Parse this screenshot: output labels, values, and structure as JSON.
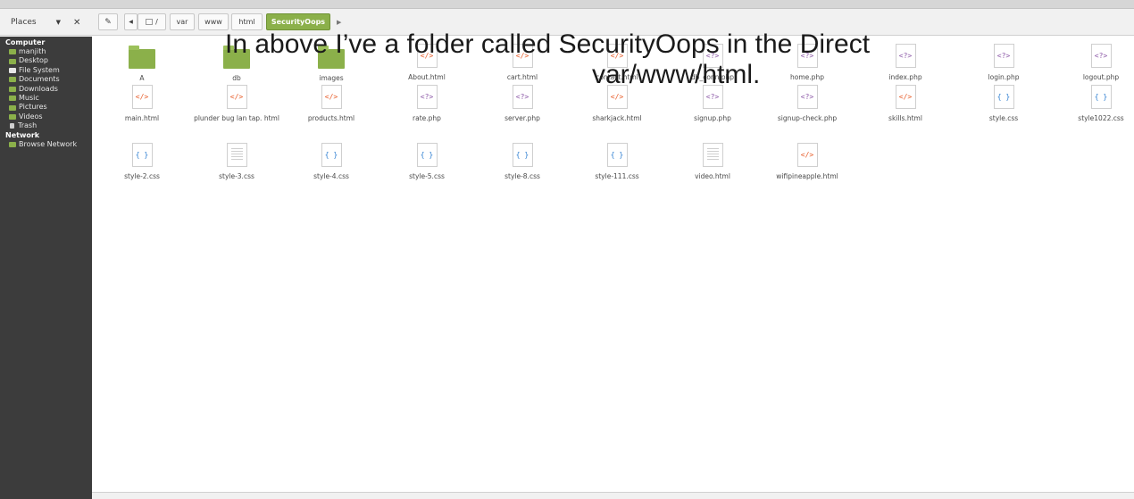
{
  "places": {
    "label": "Places"
  },
  "breadcrumbs": [
    "/",
    "var",
    "www",
    "html",
    "SecurityOops"
  ],
  "sidebar": {
    "sections": [
      {
        "heading": "Computer",
        "items": [
          {
            "label": "manjith",
            "icon": "folder-icon"
          },
          {
            "label": "Desktop",
            "icon": "folder-icon"
          },
          {
            "label": "File System",
            "icon": "drive-icon"
          },
          {
            "label": "Documents",
            "icon": "folder-icon"
          },
          {
            "label": "Downloads",
            "icon": "folder-icon"
          },
          {
            "label": "Music",
            "icon": "folder-icon"
          },
          {
            "label": "Pictures",
            "icon": "folder-icon"
          },
          {
            "label": "Videos",
            "icon": "folder-icon"
          },
          {
            "label": "Trash",
            "icon": "trash-icon"
          }
        ]
      },
      {
        "heading": "Network",
        "items": [
          {
            "label": "Browse Network",
            "icon": "network-icon"
          }
        ]
      }
    ]
  },
  "files": [
    {
      "name": "A",
      "type": "folder"
    },
    {
      "name": "db",
      "type": "folder"
    },
    {
      "name": "images",
      "type": "folder"
    },
    {
      "name": "About.html",
      "type": "html"
    },
    {
      "name": "cart.html",
      "type": "html"
    },
    {
      "name": "contact.html",
      "type": "html"
    },
    {
      "name": "db_conn.php",
      "type": "php"
    },
    {
      "name": "home.php",
      "type": "php"
    },
    {
      "name": "index.php",
      "type": "php"
    },
    {
      "name": "login.php",
      "type": "php"
    },
    {
      "name": "logout.php",
      "type": "php"
    },
    {
      "name": "main.html",
      "type": "html"
    },
    {
      "name": "plunder bug lan tap. html",
      "type": "html"
    },
    {
      "name": "products.html",
      "type": "html"
    },
    {
      "name": "rate.php",
      "type": "php"
    },
    {
      "name": "server.php",
      "type": "php"
    },
    {
      "name": "sharkjack.html",
      "type": "html"
    },
    {
      "name": "signup.php",
      "type": "php"
    },
    {
      "name": "signup-check.php",
      "type": "php"
    },
    {
      "name": "skills.html",
      "type": "html"
    },
    {
      "name": "style.css",
      "type": "css"
    },
    {
      "name": "style1022.css",
      "type": "css"
    },
    {
      "name": "style-2.css",
      "type": "css"
    },
    {
      "name": "style-3.css",
      "type": "doc"
    },
    {
      "name": "style-4.css",
      "type": "css"
    },
    {
      "name": "style-5.css",
      "type": "css"
    },
    {
      "name": "style-8.css",
      "type": "css"
    },
    {
      "name": "style-111.css",
      "type": "css"
    },
    {
      "name": "video.html",
      "type": "doc"
    },
    {
      "name": "wifipineapple.html",
      "type": "html"
    }
  ],
  "glyphs": {
    "html": "</>",
    "php": "<?>",
    "css": "{ }"
  },
  "caption": {
    "line1": "In above I’ve a folder called SecurityOops in the Direct",
    "line2": "var/www/html."
  },
  "colors": {
    "accent": "#8bb04a",
    "sidebar": "#3c3c3c",
    "html": "#e85d2a",
    "php": "#8e5ba8",
    "css": "#2f7fd1"
  }
}
